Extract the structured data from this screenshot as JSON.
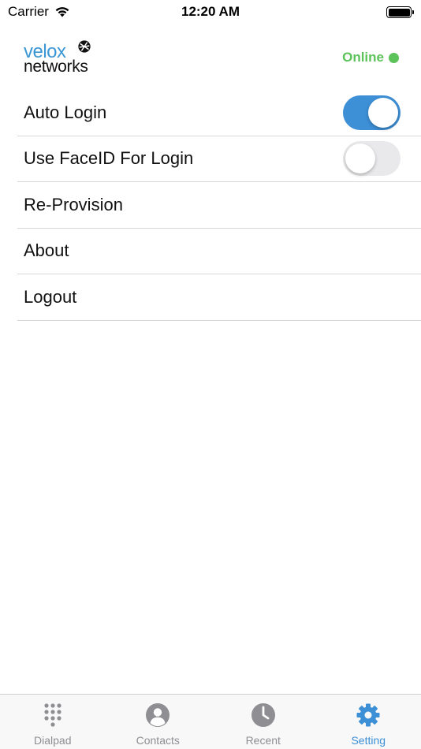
{
  "status_bar": {
    "carrier": "Carrier",
    "time": "12:20 AM"
  },
  "header": {
    "logo_line1": "velox",
    "logo_line2": "networks",
    "presence": "Online",
    "presence_color": "#5cc25a"
  },
  "settings": {
    "auto_login": {
      "label": "Auto Login",
      "enabled": true
    },
    "face_id": {
      "label": "Use FaceID For Login",
      "enabled": false
    },
    "re_provision": {
      "label": "Re-Provision"
    },
    "about": {
      "label": "About"
    },
    "logout": {
      "label": "Logout"
    }
  },
  "tabs": {
    "dialpad": {
      "label": "Dialpad",
      "icon": "dialpad-icon"
    },
    "contacts": {
      "label": "Contacts",
      "icon": "contact-icon"
    },
    "recent": {
      "label": "Recent",
      "icon": "clock-icon"
    },
    "setting": {
      "label": "Setting",
      "icon": "gear-icon",
      "active": true
    }
  },
  "colors": {
    "accent": "#3d8fd6",
    "inactive": "#8e8e93",
    "online": "#5cc25a"
  }
}
